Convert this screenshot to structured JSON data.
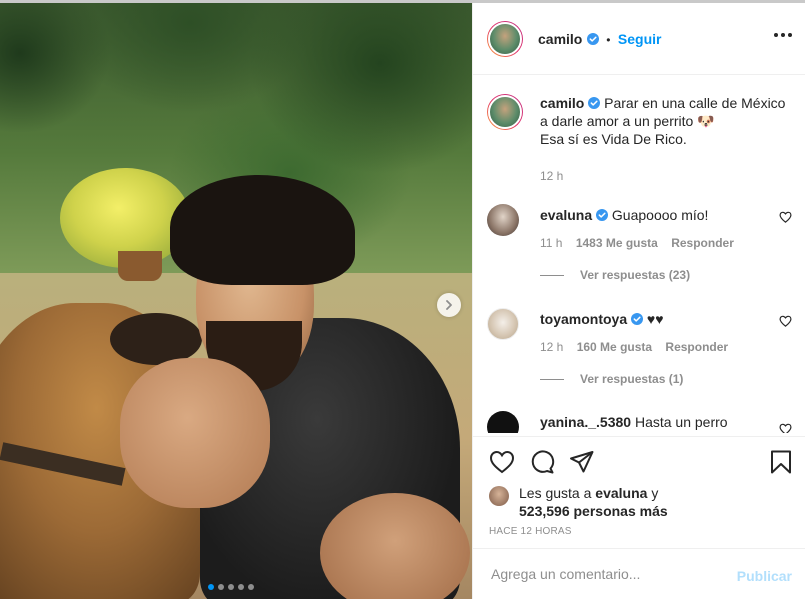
{
  "post": {
    "username": "camilo",
    "follow_label": "Seguir",
    "separator": "•",
    "verified": true,
    "carousel": {
      "slides": 5,
      "active_slide": 1
    }
  },
  "caption": {
    "username": "camilo",
    "lines": [
      "Parar en una calle de México",
      "a darle amor a un perrito 🐶",
      "Esa sí es Vida De Rico."
    ],
    "time": "12 h"
  },
  "comments": [
    {
      "username": "evaluna",
      "text": "Guapoooo mío!",
      "time": "11 h",
      "likes": "1483 Me gusta",
      "reply_label": "Responder",
      "view_replies": "Ver respuestas (23)"
    },
    {
      "username": "toyamontoya",
      "text": "♥♥",
      "time": "12 h",
      "likes": "160 Me gusta",
      "reply_label": "Responder",
      "view_replies": "Ver respuestas (1)"
    },
    {
      "username": "yanina._.5380",
      "text": "Hasta un perro"
    }
  ],
  "likes": {
    "prefix": "Les gusta a",
    "user": "evaluna",
    "conjunction": "y",
    "others": "523,596 personas más"
  },
  "time_ago": "HACE 12 HORAS",
  "add_comment": {
    "placeholder": "Agrega un comentario...",
    "post_label": "Publicar"
  },
  "colors": {
    "accent": "#0095f6",
    "muted": "#8e8e8e",
    "text": "#262626",
    "post_disabled": "#b2dffc"
  }
}
